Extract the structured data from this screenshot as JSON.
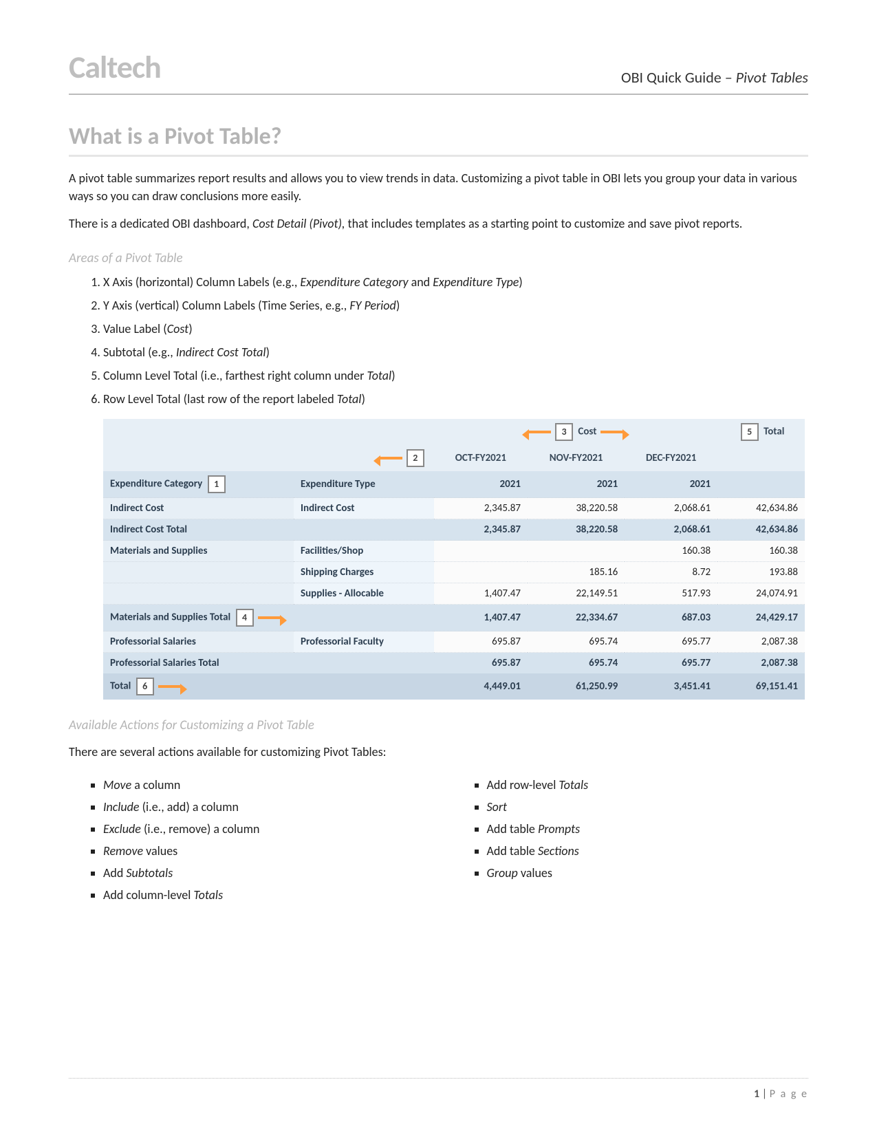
{
  "header": {
    "brand": "Caltech",
    "doc_title_a": "OBI Quick Guide – ",
    "doc_title_b": "Pivot Tables"
  },
  "section1": {
    "title": "What is a Pivot Table?",
    "p1": "A pivot table summarizes report results and allows you to view trends in data. Customizing a pivot table in OBI lets you group your data in various ways so you can draw conclusions more easily.",
    "p2a": "There is a dedicated OBI dashboard, ",
    "p2b_ital": "Cost Detail (Pivot),",
    "p2c": " that includes templates as a starting point to customize and save pivot reports."
  },
  "areas": {
    "heading": "Areas of a Pivot Table",
    "items": [
      {
        "a": "X Axis (horizontal) Column Labels (e.g., ",
        "i": "Expenditure Category",
        "b": " and ",
        "i2": "Expenditure Type",
        "c": ")"
      },
      {
        "a": "Y Axis (vertical) Column Labels (Time Series, e.g., ",
        "i": "FY Period",
        "c": ")"
      },
      {
        "a": "Value Label (",
        "i": "Cost",
        "c": ")"
      },
      {
        "a": "Subtotal (e.g., ",
        "i": "Indirect Cost Total",
        "c": ")"
      },
      {
        "a": "Column Level Total (i.e., farthest right column under ",
        "i": "Total",
        "c": ")"
      },
      {
        "a": "Row Level Total (last row of the report labeled ",
        "i": "Total",
        "c": ")"
      }
    ]
  },
  "pivot": {
    "measure": "Cost",
    "total_label": "Total",
    "col_headers": {
      "cat": "Expenditure Category",
      "type": "Expenditure Type"
    },
    "months": [
      "OCT-FY2021",
      "NOV-FY2021",
      "DEC-FY2021"
    ],
    "years": [
      "2021",
      "2021",
      "2021"
    ],
    "rows": [
      {
        "kind": "data",
        "cat": "Indirect Cost",
        "type": "Indirect Cost",
        "v": [
          "2,345.87",
          "38,220.58",
          "2,068.61",
          "42,634.86"
        ]
      },
      {
        "kind": "sub",
        "label": "Indirect Cost Total",
        "v": [
          "2,345.87",
          "38,220.58",
          "2,068.61",
          "42,634.86"
        ]
      },
      {
        "kind": "data",
        "cat": "Materials and Supplies",
        "type": "Facilities/Shop",
        "v": [
          "",
          "",
          "160.38",
          "160.38"
        ]
      },
      {
        "kind": "data",
        "cat": "",
        "type": "Shipping Charges",
        "v": [
          "",
          "185.16",
          "8.72",
          "193.88"
        ]
      },
      {
        "kind": "data",
        "cat": "",
        "type": "Supplies - Allocable",
        "v": [
          "1,407.47",
          "22,149.51",
          "517.93",
          "24,074.91"
        ]
      },
      {
        "kind": "sub",
        "label": "Materials and Supplies Total",
        "v": [
          "1,407.47",
          "22,334.67",
          "687.03",
          "24,429.17"
        ]
      },
      {
        "kind": "data",
        "cat": "Professorial Salaries",
        "type": "Professorial Faculty",
        "v": [
          "695.87",
          "695.74",
          "695.77",
          "2,087.38"
        ]
      },
      {
        "kind": "sub",
        "label": "Professorial Salaries Total",
        "v": [
          "695.87",
          "695.74",
          "695.77",
          "2,087.38"
        ]
      },
      {
        "kind": "grand",
        "label": "Total",
        "v": [
          "4,449.01",
          "61,250.99",
          "3,451.41",
          "69,151.41"
        ]
      }
    ],
    "callouts": {
      "c1": "1",
      "c2": "2",
      "c3": "3",
      "c4": "4",
      "c5": "5",
      "c6": "6"
    }
  },
  "actions": {
    "heading": "Available Actions for Customizing a Pivot Table",
    "intro": "There are several actions available for customizing Pivot Tables:",
    "left": [
      {
        "i": "Move",
        "a": " a column"
      },
      {
        "i": "Include",
        "a": " (i.e., add) a column"
      },
      {
        "i": "Exclude",
        "a": " (i.e., remove) a column"
      },
      {
        "i": "Remove",
        "a": " values"
      },
      {
        "a": "Add ",
        "i": "Subtotals"
      },
      {
        "a": "Add column-level ",
        "i": "Totals"
      }
    ],
    "right": [
      {
        "a": "Add row-level ",
        "i": "Totals"
      },
      {
        "i": "Sort"
      },
      {
        "a": "Add table ",
        "i": "Prompts"
      },
      {
        "a": "Add table ",
        "i": "Sections"
      },
      {
        "i": "Group",
        "a": " values"
      }
    ]
  },
  "footer": {
    "page_num": "1",
    "sep": " | ",
    "page_word": "P a g e"
  }
}
